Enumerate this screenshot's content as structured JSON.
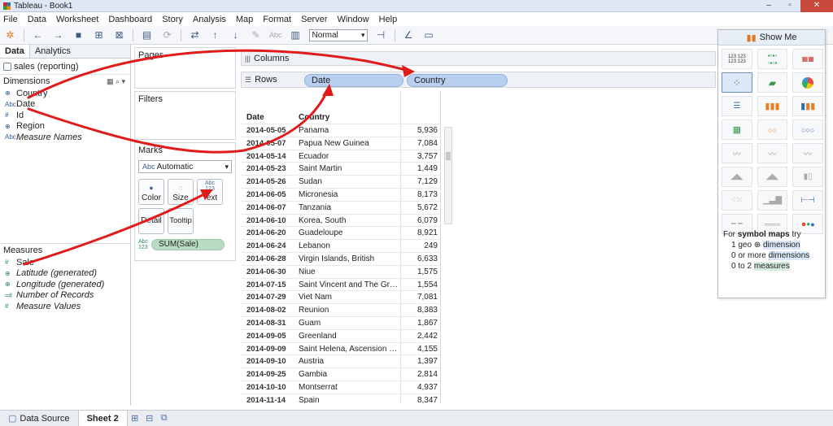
{
  "window": {
    "title": "Tableau - Book1"
  },
  "menu": [
    "File",
    "Data",
    "Worksheet",
    "Dashboard",
    "Story",
    "Analysis",
    "Map",
    "Format",
    "Server",
    "Window",
    "Help"
  ],
  "toolbar": {
    "fit_mode": "Normal",
    "label_button": "Abc"
  },
  "left_panel": {
    "tabs": [
      "Data",
      "Analytics"
    ],
    "data_source": "sales (reporting)",
    "dimensions_header": "Dimensions",
    "dimensions": [
      {
        "icon": "⊕",
        "label": "Country",
        "italic": false
      },
      {
        "icon": "Abc",
        "label": "Date",
        "italic": false
      },
      {
        "icon": "#",
        "label": "Id",
        "italic": false
      },
      {
        "icon": "⊕",
        "label": "Region",
        "italic": false
      },
      {
        "icon": "Abc",
        "label": "Measure Names",
        "italic": true
      }
    ],
    "measures_header": "Measures",
    "measures": [
      {
        "icon": "#",
        "label": "Sale",
        "italic": false
      },
      {
        "icon": "⊕",
        "label": "Latitude (generated)",
        "italic": true
      },
      {
        "icon": "⊕",
        "label": "Longitude (generated)",
        "italic": true
      },
      {
        "icon": "=#",
        "label": "Number of Records",
        "italic": true
      },
      {
        "icon": "#",
        "label": "Measure Values",
        "italic": true
      }
    ]
  },
  "cards": {
    "pages": "Pages",
    "filters": "Filters",
    "marks": "Marks",
    "marks_type_icon": "Abc",
    "marks_type": "Automatic",
    "buttons": {
      "color": "Color",
      "size": "Size",
      "text": "Text",
      "detail": "Detail",
      "tooltip": "Tooltip"
    },
    "text_icon": "Abc 123",
    "sum_pill_icon": "Abc 123",
    "sum_pill": "SUM(Sale)"
  },
  "shelves": {
    "columns_label": "Columns",
    "rows_label": "Rows",
    "rows_pills": [
      "Date",
      "Country"
    ]
  },
  "table": {
    "headers": [
      "Date",
      "Country"
    ],
    "rows": [
      [
        "2014-05-05",
        "Panama",
        "5,936"
      ],
      [
        "2014-05-07",
        "Papua New Guinea",
        "7,084"
      ],
      [
        "2014-05-14",
        "Ecuador",
        "3,757"
      ],
      [
        "2014-05-23",
        "Saint Martin",
        "1,449"
      ],
      [
        "2014-05-26",
        "Sudan",
        "7,129"
      ],
      [
        "2014-06-05",
        "Micronesia",
        "8,173"
      ],
      [
        "2014-06-07",
        "Tanzania",
        "5,672"
      ],
      [
        "2014-06-10",
        "Korea, South",
        "6,079"
      ],
      [
        "2014-06-20",
        "Guadeloupe",
        "8,921"
      ],
      [
        "2014-06-24",
        "Lebanon",
        "249"
      ],
      [
        "2014-06-28",
        "Virgin Islands, British",
        "6,633"
      ],
      [
        "2014-06-30",
        "Niue",
        "1,575"
      ],
      [
        "2014-07-15",
        "Saint Vincent and The Grenad..",
        "1,554"
      ],
      [
        "2014-07-29",
        "Viet Nam",
        "7,081"
      ],
      [
        "2014-08-02",
        "Reunion",
        "8,383"
      ],
      [
        "2014-08-31",
        "Guam",
        "1,867"
      ],
      [
        "2014-09-05",
        "Greenland",
        "2,442"
      ],
      [
        "2014-09-09",
        "Saint Helena, Ascension and ..",
        "4,155"
      ],
      [
        "2014-09-10",
        "Austria",
        "1,397"
      ],
      [
        "2014-09-25",
        "Gambia",
        "2,814"
      ],
      [
        "2014-10-10",
        "Montserrat",
        "4,937"
      ],
      [
        "2014-11-14",
        "Spain",
        "8,347"
      ]
    ]
  },
  "showme": {
    "title": "Show Me",
    "tip": {
      "line1_prefix": "For",
      "line1_bold": "symbol maps",
      "line1_suffix": "try",
      "line2_prefix": "1 geo ⊕",
      "line2_hl": "dimension",
      "line3_prefix": "0 or more",
      "line3_hl": "dimensions",
      "line4_prefix": "0 to 2",
      "line4_hl": "measures"
    }
  },
  "bottom": {
    "datasource_tab": "Data Source",
    "sheet_tab": "Sheet 2"
  },
  "colors": {
    "row_pill": "#b9cff0",
    "measure_pill": "#b9dcc2",
    "annotation": "#e01b1b"
  }
}
